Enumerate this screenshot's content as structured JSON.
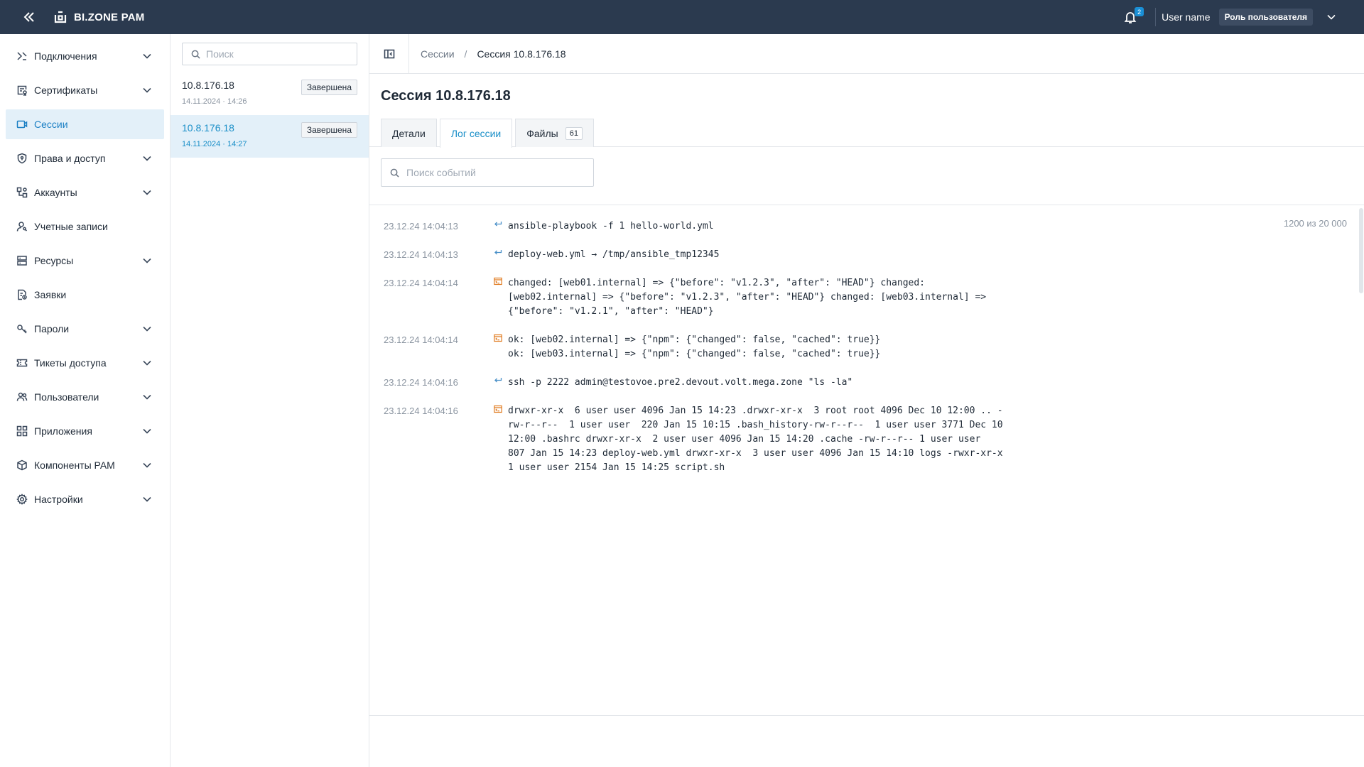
{
  "topbar": {
    "product": "BI.ZONE PAM",
    "notifications_count": "2",
    "user_name": "User name",
    "user_role": "Роль пользователя"
  },
  "sidebar": {
    "items": [
      {
        "label": "Подключения",
        "icon": "connections-icon",
        "has_children": true
      },
      {
        "label": "Сертификаты",
        "icon": "certificate-icon",
        "has_children": true
      },
      {
        "label": "Сессии",
        "icon": "video-icon",
        "has_children": false,
        "active": true
      },
      {
        "label": "Права и доступ",
        "icon": "shield-icon",
        "has_children": true
      },
      {
        "label": "Аккаунты",
        "icon": "accounts-icon",
        "has_children": true
      },
      {
        "label": "Учетные записи",
        "icon": "user-key-icon",
        "has_children": false
      },
      {
        "label": "Ресурсы",
        "icon": "server-icon",
        "has_children": true
      },
      {
        "label": "Заявки",
        "icon": "request-icon",
        "has_children": false
      },
      {
        "label": "Пароли",
        "icon": "key-icon",
        "has_children": true
      },
      {
        "label": "Тикеты доступа",
        "icon": "ticket-icon",
        "has_children": true
      },
      {
        "label": "Пользователи",
        "icon": "users-icon",
        "has_children": true
      },
      {
        "label": "Приложения",
        "icon": "apps-icon",
        "has_children": true
      },
      {
        "label": "Компоненты PAM",
        "icon": "components-icon",
        "has_children": true
      },
      {
        "label": "Настройки",
        "icon": "gear-icon",
        "has_children": true
      }
    ]
  },
  "session_list": {
    "search_placeholder": "Поиск",
    "items": [
      {
        "ip": "10.8.176.18",
        "datetime": "14.11.2024 · 14:26",
        "status": "Завершена",
        "active": false
      },
      {
        "ip": "10.8.176.18",
        "datetime": "14.11.2024 · 14:27",
        "status": "Завершена",
        "active": true
      }
    ]
  },
  "main": {
    "breadcrumb": {
      "parent": "Сессии",
      "separator": "/",
      "current": "Сессия 10.8.176.18"
    },
    "title": "Сессия 10.8.176.18",
    "tabs": [
      {
        "label": "Детали",
        "active": false
      },
      {
        "label": "Лог сессии",
        "active": true
      },
      {
        "label": "Файлы",
        "count": "61",
        "active": false
      }
    ],
    "event_search_placeholder": "Поиск событий",
    "log_counter": "1200 из 20 000",
    "log": [
      {
        "time": "23.12.24 14:04:13",
        "type": "command",
        "text": "ansible-playbook -f 1 hello-world.yml"
      },
      {
        "time": "23.12.24 14:04:13",
        "type": "command",
        "text": "deploy-web.yml → /tmp/ansible_tmp12345"
      },
      {
        "time": "23.12.24 14:04:14",
        "type": "output",
        "text": "changed: [web01.internal] => {\"before\": \"v1.2.3\", \"after\": \"HEAD\"} changed: [web02.internal] => {\"before\": \"v1.2.3\", \"after\": \"HEAD\"} changed: [web03.internal] => {\"before\": \"v1.2.1\", \"after\": \"HEAD\"}"
      },
      {
        "time": "23.12.24 14:04:14",
        "type": "output",
        "text": "ok: [web02.internal] => {\"npm\": {\"changed\": false, \"cached\": true}}\nok: [web03.internal] => {\"npm\": {\"changed\": false, \"cached\": true}}"
      },
      {
        "time": "23.12.24 14:04:16",
        "type": "command",
        "text": "ssh -p 2222 admin@testovoe.pre2.devout.volt.mega.zone \"ls -la\""
      },
      {
        "time": "23.12.24 14:04:16",
        "type": "output",
        "text": "drwxr-xr-x  6 user user 4096 Jan 15 14:23 .drwxr-xr-x  3 root root 4096 Dec 10 12:00 .. -rw-r--r--  1 user user  220 Jan 15 10:15 .bash_history-rw-r--r--  1 user user 3771 Dec 10 12:00 .bashrc drwxr-xr-x  2 user user 4096 Jan 15 14:20 .cache -rw-r--r-- 1 user user  807 Jan 15 14:23 deploy-web.yml drwxr-xr-x  3 user user 4096 Jan 15 14:10 logs -rwxr-xr-x  1 user user 2154 Jan 15 14:25 script.sh"
      }
    ]
  },
  "colors": {
    "topbar_bg": "#2b3a4f",
    "accent": "#1a8fc8",
    "active_bg": "#e3f0f9",
    "output_icon": "#e07a1f"
  }
}
